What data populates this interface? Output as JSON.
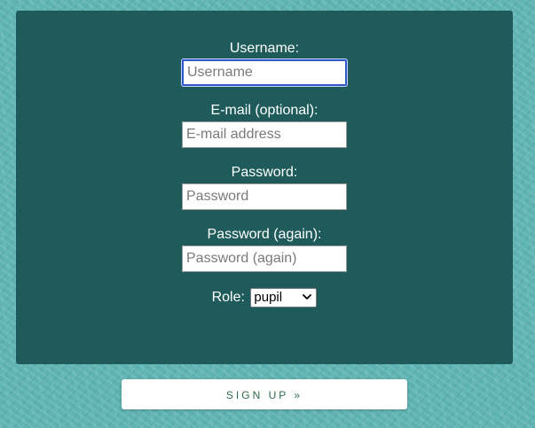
{
  "form": {
    "username": {
      "label": "Username:",
      "placeholder": "Username",
      "value": ""
    },
    "email": {
      "label": "E-mail (optional):",
      "placeholder": "E-mail address",
      "value": ""
    },
    "password": {
      "label": "Password:",
      "placeholder": "Password",
      "value": ""
    },
    "password_again": {
      "label": "Password (again):",
      "placeholder": "Password (again)",
      "value": ""
    },
    "role": {
      "label": "Role:",
      "selected": "pupil"
    },
    "submit_label": "SIGN UP »"
  },
  "colors": {
    "page_background": "#5fb3b3",
    "panel_background": "#1e5b5a",
    "focus_ring": "#2f56c9",
    "button_text": "#2e6a4a"
  },
  "icons": {
    "role_select_arrow": "chevron-down-icon"
  }
}
